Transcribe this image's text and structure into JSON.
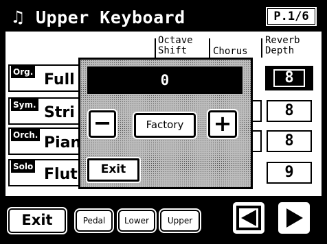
{
  "title": {
    "icon": "music-notes-icon",
    "glyph": "♫",
    "text": "Upper Keyboard"
  },
  "page_indicator": "P.1/6",
  "columns": {
    "octave_shift": "Octave\nShift",
    "chorus": "Chorus",
    "reverb_depth": "Reverb\nDepth"
  },
  "parts": [
    {
      "tag": "Org.",
      "name": "Full",
      "reverb": "8"
    },
    {
      "tag": "Sym.",
      "name": "Stri",
      "reverb": "8"
    },
    {
      "tag": "Orch.",
      "name": "Pian",
      "reverb": "8"
    },
    {
      "tag": "Solo",
      "name": "Flut",
      "reverb": "9"
    }
  ],
  "dialog": {
    "value": "0",
    "minus_label": "−",
    "factory_label": "Factory",
    "plus_label": "+",
    "exit_label": "Exit"
  },
  "bottom": {
    "exit_label": "Exit",
    "pedal_label": "Pedal",
    "lower_label": "Lower",
    "upper_label": "Upper"
  },
  "colors": {
    "foreground": "#000000",
    "background": "#ffffff",
    "dialog": "#bdbdbd"
  }
}
